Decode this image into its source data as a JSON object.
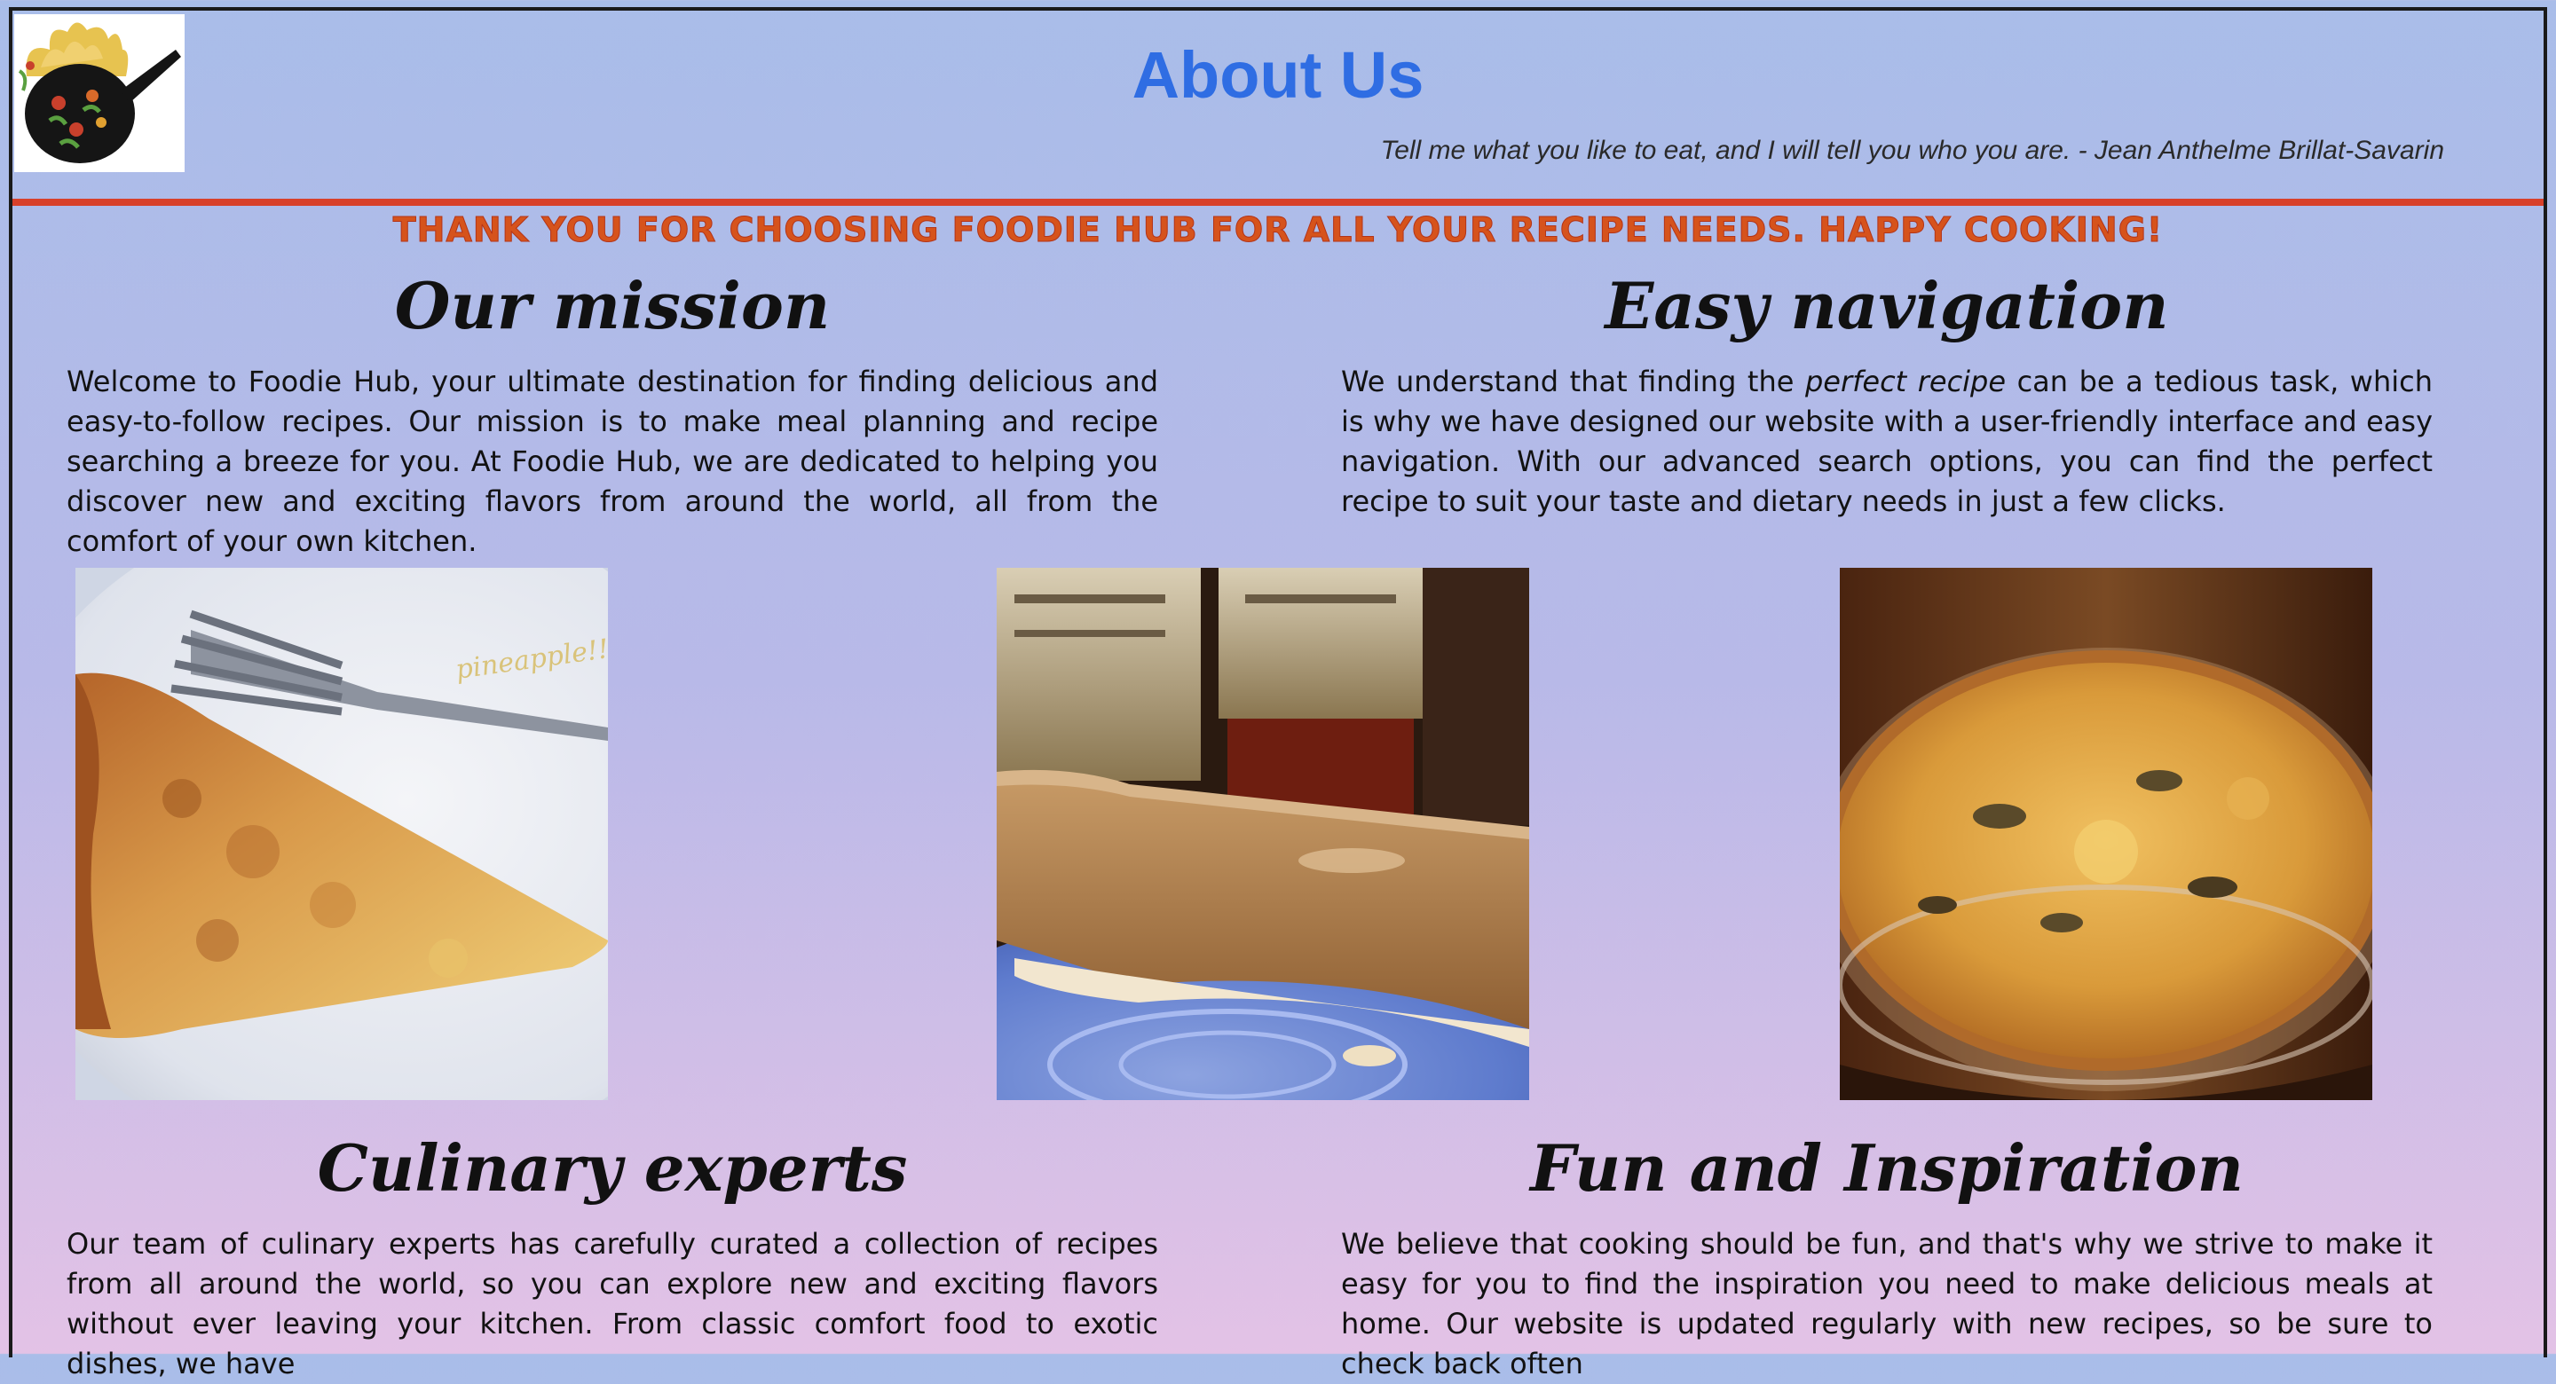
{
  "header": {
    "title": "About Us",
    "tagline": "Tell me what you like to eat, and I will tell you who you are. - Jean Anthelme Brillat-Savarin",
    "logo_icon": "frying-pan-logo-icon"
  },
  "banner": {
    "text": "Thank you for choosing Foodie Hub for all your recipe needs. Happy cooking!"
  },
  "sections": {
    "mission": {
      "heading": "Our mission",
      "body": "Welcome to Foodie Hub, your ultimate destination for finding delicious and easy-to-follow recipes. Our mission is to make meal planning and recipe searching a breeze for you. At Foodie Hub, we are dedicated to helping you discover new and exciting flavors from around the world, all from the comfort of your own kitchen."
    },
    "navigation": {
      "heading": "Easy navigation",
      "body_before": "We understand that finding the ",
      "body_emphasis": "perfect recipe",
      "body_after": " can be a tedious task, which is why we have designed our website with a user-friendly interface and easy navigation. With our advanced search options, you can find the perfect recipe to suit your taste and dietary needs in just a few clicks."
    },
    "experts": {
      "heading": "Culinary experts",
      "body": "Our team of culinary experts has carefully curated a collection of recipes from all around the world, so you can explore new and exciting flavors without ever leaving your kitchen. From classic comfort food to exotic dishes, we have"
    },
    "inspiration": {
      "heading": "Fun and Inspiration",
      "body": "We believe that cooking should be fun, and that's why we strive to make it easy for you to find the inspiration you need to make delicious meals at home. Our website is updated regularly with new recipes, so be sure to check back often"
    }
  },
  "photos": {
    "pie_slice_text": "pineapple!!"
  },
  "colors": {
    "title": "#2f6de3",
    "rule": "#d8402a",
    "banner": "#d6531c",
    "bg_top": "#a9bde9",
    "bg_bottom": "#e3c2e6"
  }
}
